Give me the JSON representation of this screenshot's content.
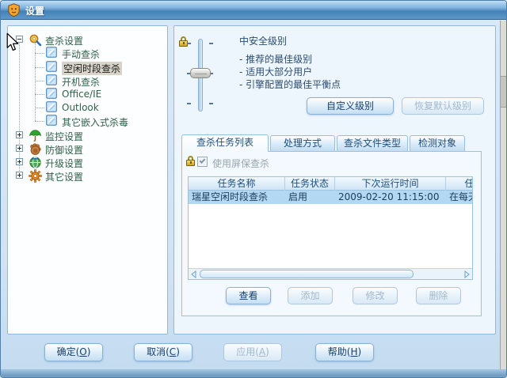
{
  "window": {
    "title": "设置"
  },
  "tree": {
    "root": {
      "label": "查杀设置"
    },
    "children": [
      {
        "label": "手动查杀"
      },
      {
        "label": "空闲时段查杀"
      },
      {
        "label": "开机查杀"
      },
      {
        "label": "Office/IE"
      },
      {
        "label": "Outlook"
      },
      {
        "label": "其它嵌入式杀毒"
      }
    ],
    "selected": "空闲时段查杀",
    "groups": [
      {
        "label": "监控设置"
      },
      {
        "label": "防御设置"
      },
      {
        "label": "升级设置"
      },
      {
        "label": "其它设置"
      }
    ]
  },
  "security": {
    "title": "中安全级别",
    "bullets": [
      "- 推荐的最佳级别",
      "- 适用大部分用户",
      "- 引擎配置的最佳平衡点"
    ],
    "custom_level": "自定义级别",
    "restore_default": "恢复默认级别"
  },
  "tabs": [
    {
      "label": "查杀任务列表"
    },
    {
      "label": "处理方式"
    },
    {
      "label": "查杀文件类型"
    },
    {
      "label": "检测对象"
    }
  ],
  "screensaver": {
    "label": "使用屏保查杀",
    "checked": true
  },
  "task_table": {
    "headers": [
      "任务名称",
      "任务状态",
      "下次运行时间",
      "任务运行时间"
    ],
    "row": [
      "瑞星空闲时段查杀",
      "启用",
      "2009-02-20 11:15:00",
      "在每天"
    ]
  },
  "task_buttons": {
    "view": "查看",
    "add": "添加",
    "modify": "修改",
    "remove": "删除"
  },
  "dialog_buttons": {
    "ok": {
      "pre": "确定(",
      "key": "O",
      "post": ")"
    },
    "cancel": {
      "pre": "取消(",
      "key": "C",
      "post": ")"
    },
    "apply": {
      "pre": "应用(",
      "key": "A",
      "post": ")"
    },
    "help": {
      "pre": "帮助(",
      "key": "H",
      "post": ")"
    }
  },
  "colors": {
    "titlebar": "#4381b7",
    "panel_border": "#8fb9de",
    "row_selection": "#b2d8f2",
    "tree_text": "#2f6147",
    "tree_selection_bg": "#d8d4ca"
  }
}
